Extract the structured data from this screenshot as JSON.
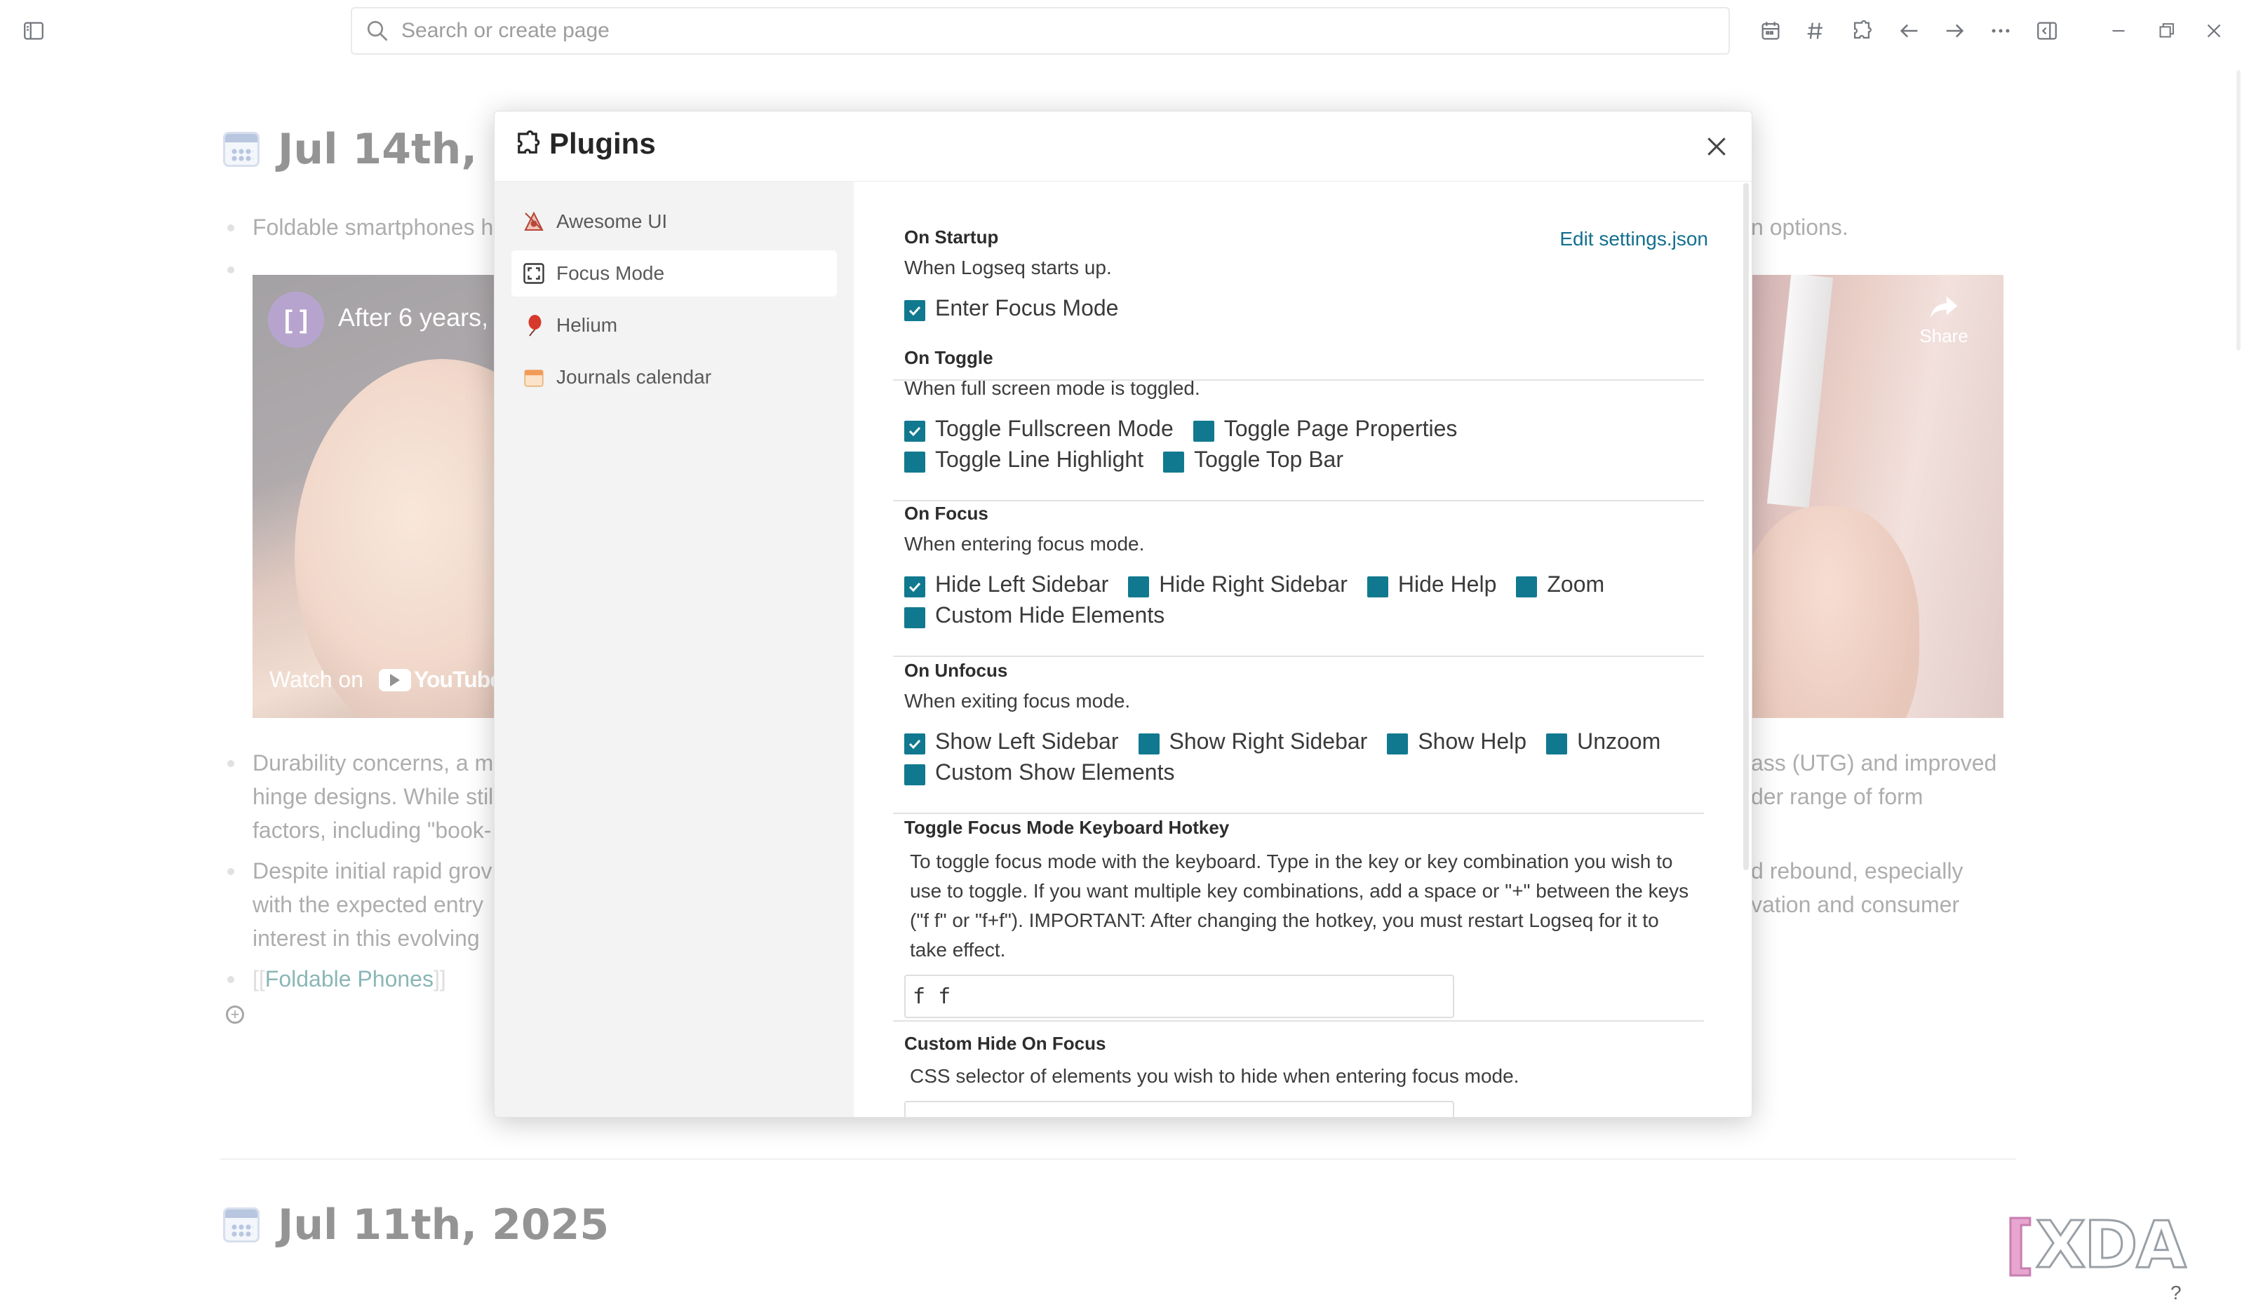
{
  "topbar": {
    "search_placeholder": "Search or create page"
  },
  "background": {
    "journal1_title": "Jul 14th, 2",
    "journal2_title": "Jul 11th, 2025",
    "line_foldable_left": "Foldable smartphones h",
    "line_foldable_right": "n options.",
    "video_title": "After 6 years, ",
    "video_watch": "Watch on",
    "video_youtube": "YouTube",
    "video_share": "Share",
    "durability_l1": "Durability concerns, a m",
    "durability_l2": "hinge designs. While stil",
    "durability_l3": "factors, including \"book-",
    "durability_r1": "ass (UTG) and improved",
    "durability_r2": "der range of form",
    "despite_l1": "Despite initial rapid grov",
    "despite_l2": "with the expected entry",
    "despite_l3": "interest in this evolving ",
    "despite_r1": "d rebound, especially",
    "despite_r2": "vation and consumer",
    "link_open": "[[",
    "link_label": "Foldable Phones",
    "link_close": "]]",
    "watermark": "XDA",
    "help": "?"
  },
  "modal": {
    "title": "Plugins",
    "edit_link": "Edit settings.json",
    "sidebar": [
      {
        "label": "Awesome UI"
      },
      {
        "label": "Focus Mode"
      },
      {
        "label": "Helium"
      },
      {
        "label": "Journals calendar"
      }
    ],
    "sections": {
      "startup": {
        "title": "On Startup",
        "desc": "When Logseq starts up.",
        "options": [
          "Enter Focus Mode"
        ]
      },
      "toggle": {
        "title": "On Toggle",
        "desc": "When full screen mode is toggled.",
        "options": [
          "Toggle Fullscreen Mode",
          "Toggle Page Properties",
          "Toggle Line Highlight",
          "Toggle Top Bar"
        ]
      },
      "focus": {
        "title": "On Focus",
        "desc": "When entering focus mode.",
        "options": [
          "Hide Left Sidebar",
          "Hide Right Sidebar",
          "Hide Help",
          "Zoom",
          "Custom Hide Elements"
        ]
      },
      "unfocus": {
        "title": "On Unfocus",
        "desc": "When exiting focus mode.",
        "options": [
          "Show Left Sidebar",
          "Show Right Sidebar",
          "Show Help",
          "Unzoom",
          "Custom Show Elements"
        ]
      },
      "hotkey": {
        "title": "Toggle Focus Mode Keyboard Hotkey",
        "desc": "To toggle focus mode with the keyboard. Type in the key or key combination you wish to use to toggle. If you want multiple key combinations, add a space or \"+\" between the keys (\"f f\" or \"f+f\"). IMPORTANT: After changing the hotkey, you must restart Logseq for it to take effect.",
        "value": "f f"
      },
      "custom_hide": {
        "title": "Custom Hide On Focus",
        "desc": "CSS selector of elements you wish to hide when entering focus mode.",
        "value": ""
      }
    }
  },
  "colors": {
    "accent": "#11798f",
    "link": "#136f8f"
  }
}
